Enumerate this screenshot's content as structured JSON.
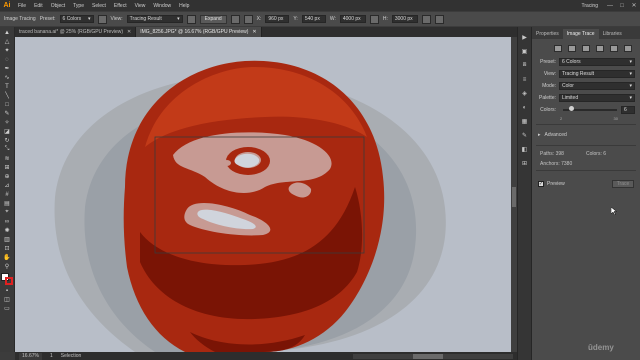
{
  "app": {
    "logo": "Ai"
  },
  "menu": [
    "File",
    "Edit",
    "Object",
    "Type",
    "Select",
    "Effect",
    "View",
    "Window",
    "Help"
  ],
  "workspace": "Tracing",
  "window_controls": [
    "—",
    "□",
    "✕"
  ],
  "controlbar": {
    "mode_label": "Image Tracing",
    "preset_label": "Preset:",
    "preset_value": "6 Colors",
    "view_label": "View:",
    "view_value": "Tracing Result",
    "expand_button": "Expand",
    "x_value": "960 px",
    "y_value": "540 px",
    "w_value": "4000 px",
    "h_value": "3000 px"
  },
  "tabs": [
    {
      "label": "traced banana.ai* @ 25% (RGB/GPU Preview)",
      "close": "✕",
      "active": false
    },
    {
      "label": "IMG_8256.JPG* @ 16.67% (RGB/GPU Preview)",
      "close": "✕",
      "active": true
    }
  ],
  "status": {
    "zoom": "16.67%",
    "page": "1",
    "tool": "Selection"
  },
  "panel": {
    "tabs": [
      "Properties",
      "Image Trace",
      "Libraries"
    ],
    "active_tab": "Image Trace",
    "preset_label": "Preset:",
    "preset_value": "6 Colors",
    "view_label": "View:",
    "view_value": "Tracing Result",
    "mode_label": "Mode:",
    "mode_value": "Color",
    "palette_label": "Palette:",
    "palette_value": "Limited",
    "colors_label": "Colors:",
    "colors_value": "6",
    "slider_min": "2",
    "slider_max": "30",
    "colors_level_fraction": 0.15,
    "advanced_label": "Advanced",
    "paths_label": "Paths:",
    "paths_value": "398",
    "colors_info_label": "Colors:",
    "colors_info_value": "6",
    "anchors_label": "Anchors:",
    "anchors_value": "7380",
    "preview_label": "Preview",
    "preview_checked": true,
    "trace_button": "Trace"
  },
  "watermark": "ûdemy",
  "colors": {
    "canvas_bg": "#b8bec8",
    "halo_outer": "#a9adb2",
    "halo_inner": "#8f959c",
    "tomato_dark": "#7a1405",
    "tomato_main": "#a82810",
    "tomato_light": "#c23a18",
    "highlight": "#c79a93",
    "highlight_bright": "#d0d4dc",
    "accent_orange": "#ff9a00"
  }
}
